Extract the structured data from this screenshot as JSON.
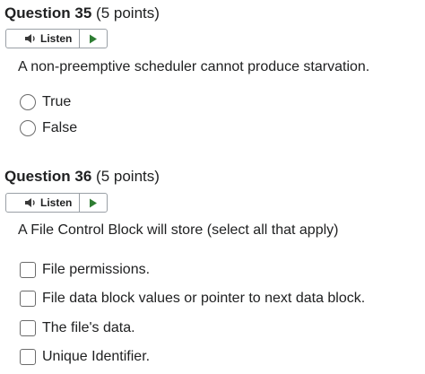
{
  "questions": [
    {
      "number_label": "Question 35",
      "points_label": "(5 points)",
      "listen_label": "Listen",
      "prompt": "A non-preemptive scheduler cannot produce starvation.",
      "options": [
        "True",
        "False"
      ]
    },
    {
      "number_label": "Question 36",
      "points_label": "(5 points)",
      "listen_label": "Listen",
      "prompt": "A File Control Block will store (select all that apply)",
      "options": [
        "File permissions.",
        "File data block values or pointer to next data block.",
        "The file's data.",
        "Unique Identifier."
      ]
    }
  ],
  "colors": {
    "text": "#202122",
    "border": "#9aa0a6",
    "play_icon": "#2e7d32",
    "speaker_icon": "#3a3a3a"
  },
  "icons": {
    "speaker": "speaker-icon",
    "play": "play-icon"
  }
}
